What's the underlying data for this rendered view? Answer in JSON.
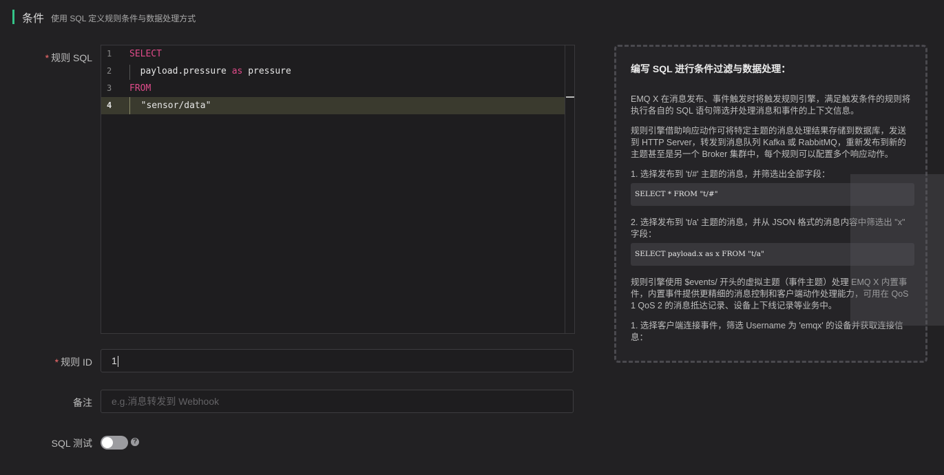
{
  "section": {
    "title": "条件",
    "subtitle": "使用 SQL 定义规则条件与数据处理方式"
  },
  "form": {
    "sql_label": "规则 SQL",
    "rule_id_label": "规则 ID",
    "note_label": "备注",
    "sql_test_label": "SQL 测试",
    "required_mark": "*",
    "rule_id_value": "1",
    "note_placeholder": "e.g.消息转发到 Webhook",
    "sql_test_enabled": false
  },
  "editor": {
    "lines": [
      {
        "no": "1",
        "parts": [
          {
            "t": "SELECT",
            "kw": true
          }
        ]
      },
      {
        "no": "2",
        "parts": [
          {
            "t": "  payload.pressure ",
            "kw": false
          },
          {
            "t": "as",
            "kw": true
          },
          {
            "t": " pressure",
            "kw": false
          }
        ]
      },
      {
        "no": "3",
        "parts": [
          {
            "t": "FROM",
            "kw": true
          }
        ]
      },
      {
        "no": "4",
        "parts": [
          {
            "t": "  \"sensor/data\"",
            "kw": false
          }
        ]
      }
    ],
    "current_line": 4
  },
  "help": {
    "title": "编写 SQL 进行条件过滤与数据处理：",
    "p1": "EMQ X 在消息发布、事件触发时将触发规则引擎，满足触发条件的规则将执行各自的 SQL 语句筛选并处理消息和事件的上下文信息。",
    "p2": "规则引擎借助响应动作可将特定主题的消息处理结果存储到数据库，发送到 HTTP Server，转发到消息队列 Kafka 或 RabbitMQ，重新发布到新的主题甚至是另一个 Broker 集群中，每个规则可以配置多个响应动作。",
    "step1": "1. 选择发布到 't/#' 主题的消息，并筛选出全部字段：",
    "code1": "SELECT * FROM \"t/#\"",
    "step2": "2. 选择发布到 't/a' 主题的消息，并从 JSON 格式的消息内容中筛选出 \"x\" 字段：",
    "code2": "SELECT payload.x as x FROM \"t/a\"",
    "p3": "规则引擎使用 $events/ 开头的虚拟主题（事件主题）处理 EMQ X 内置事件，内置事件提供更精细的消息控制和客户端动作处理能力，可用在 QoS 1 QoS 2 的消息抵达记录、设备上下线记录等业务中。",
    "step3": "1. 选择客户端连接事件，筛选 Username 为 'emqx' 的设备并获取连接信息："
  },
  "icons": {
    "help": "question-circle-icon"
  },
  "colors": {
    "accent": "#34c388",
    "keyword": "#e04b8a",
    "required": "#f56c6c"
  }
}
